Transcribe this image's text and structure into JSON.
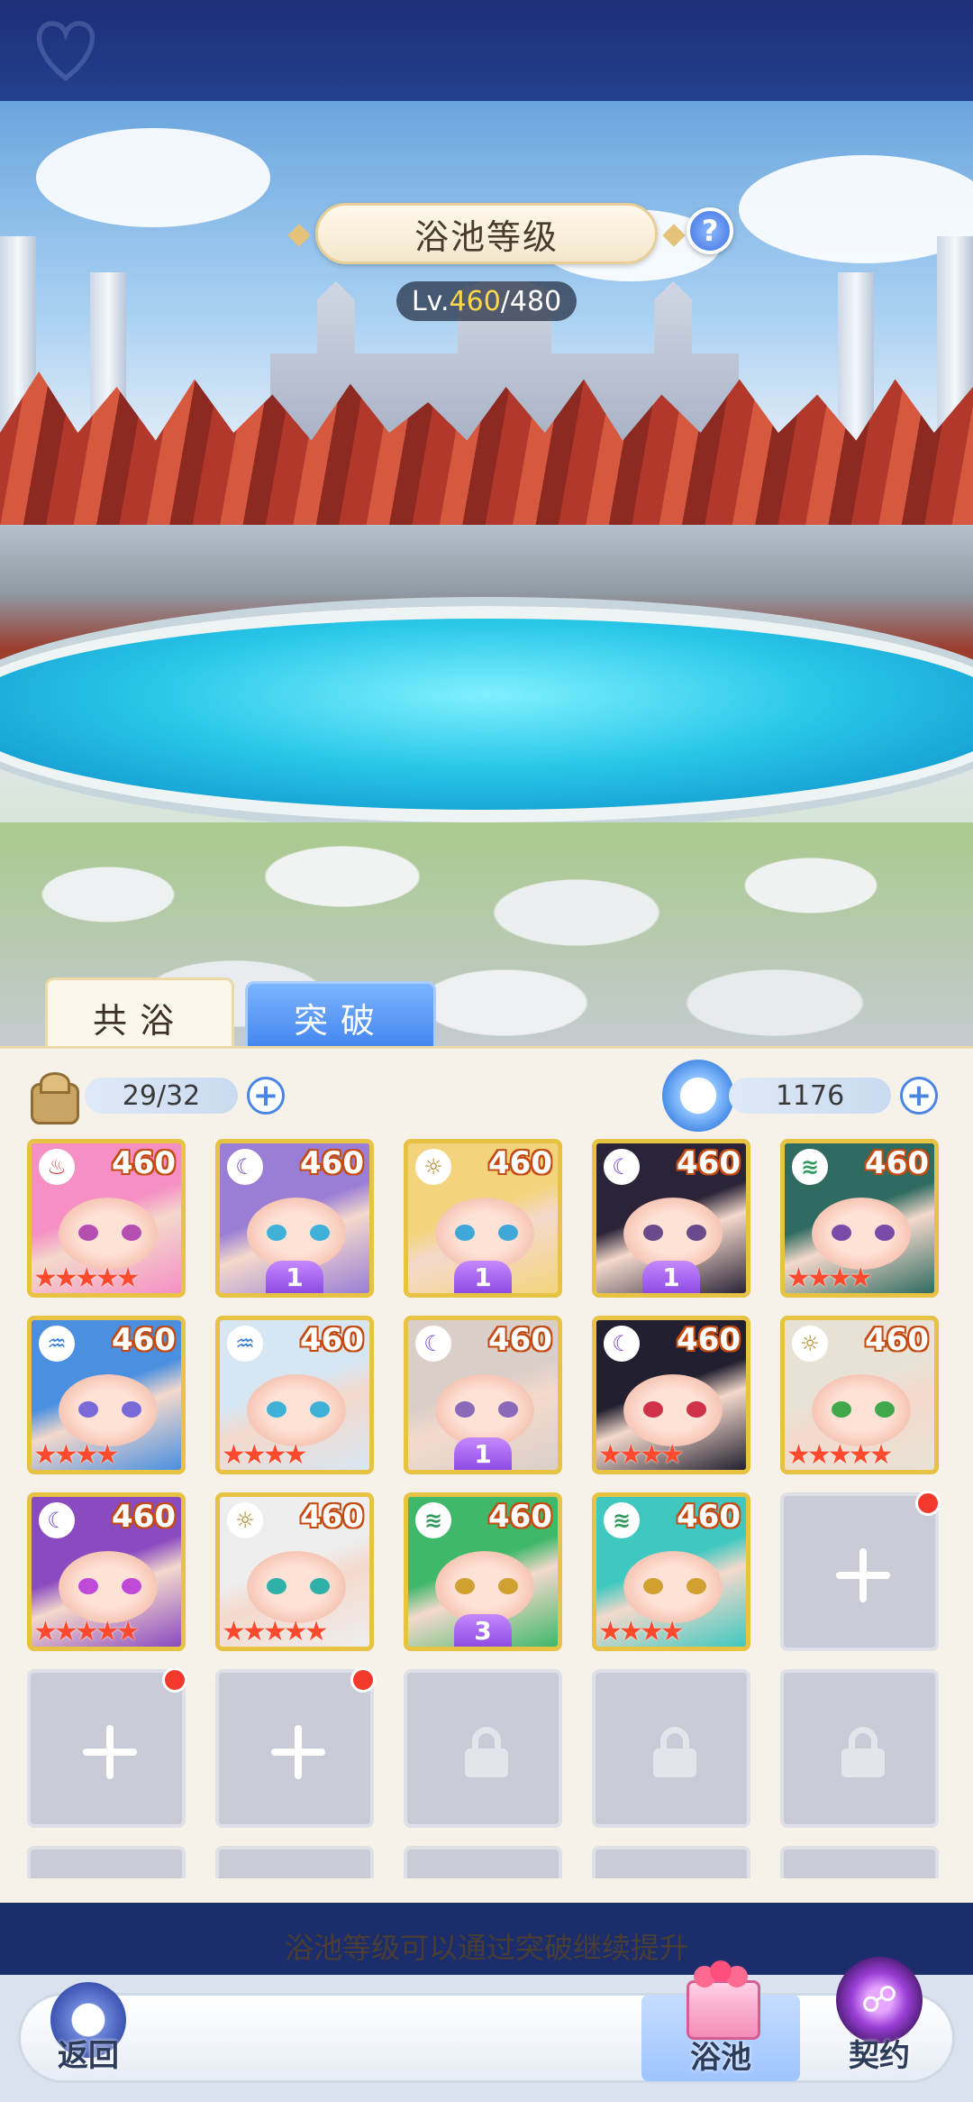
{
  "header": {
    "title": "浴池等级",
    "help_label": "?",
    "level_current": "460",
    "level_max": "/480",
    "level_prefix": "Lv."
  },
  "tabs": [
    {
      "label": "共浴",
      "active": true
    },
    {
      "label": "突破",
      "active": false
    }
  ],
  "resources": {
    "slots_value": "29/32",
    "slots_icon": "bag-icon",
    "currency_value": "1176",
    "currency_icon": "rabbit-water-icon"
  },
  "cards": [
    {
      "level": "460",
      "element": "fire",
      "stars": 5,
      "awaken": "",
      "hair": "#f58fc4",
      "eye": "#b44fb0"
    },
    {
      "level": "460",
      "element": "moon",
      "stars": 0,
      "awaken": "1",
      "hair": "#9a7ed6",
      "eye": "#3fb0d8"
    },
    {
      "level": "460",
      "element": "light",
      "stars": 0,
      "awaken": "1",
      "hair": "#f3d47c",
      "eye": "#3fa8d8"
    },
    {
      "level": "460",
      "element": "moon",
      "stars": 0,
      "awaken": "1",
      "hair": "#2b2438",
      "eye": "#6a4a8a"
    },
    {
      "level": "460",
      "element": "wind",
      "stars": 4,
      "awaken": "",
      "hair": "#2f6b60",
      "eye": "#7a4aa8"
    },
    {
      "level": "460",
      "element": "water",
      "stars": 4,
      "awaken": "",
      "hair": "#4a8fe0",
      "eye": "#7a6ad8"
    },
    {
      "level": "460",
      "element": "water",
      "stars": 4,
      "awaken": "",
      "hair": "#d7e6f3",
      "eye": "#3fb0d8"
    },
    {
      "level": "460",
      "element": "moon",
      "stars": 0,
      "awaken": "1",
      "hair": "#d9cfc8",
      "eye": "#8a6ab8"
    },
    {
      "level": "460",
      "element": "moon",
      "stars": 4,
      "awaken": "",
      "hair": "#222030",
      "eye": "#d0304a"
    },
    {
      "level": "460",
      "element": "light",
      "stars": 5,
      "awaken": "",
      "hair": "#e8e2d6",
      "eye": "#3fa84a"
    },
    {
      "level": "460",
      "element": "moon",
      "stars": 5,
      "awaken": "",
      "hair": "#8a4ac0",
      "eye": "#c04ad8"
    },
    {
      "level": "460",
      "element": "light",
      "stars": 5,
      "awaken": "",
      "hair": "#eeeeee",
      "eye": "#2fb0a8"
    },
    {
      "level": "460",
      "element": "wind",
      "stars": 0,
      "awaken": "3",
      "hair": "#3fb86a",
      "eye": "#d0a030"
    },
    {
      "level": "460",
      "element": "wind",
      "stars": 4,
      "awaken": "",
      "hair": "#3fc8c0",
      "eye": "#d0a030"
    }
  ],
  "element_glyphs": {
    "fire": "♨",
    "moon": "☾",
    "light": "☼",
    "wind": "≋",
    "water": "♒"
  },
  "element_colors": {
    "fire": "#d23a3a",
    "moon": "#7a4ad0",
    "light": "#b08a2a",
    "wind": "#2f9a5a",
    "water": "#2f7ad8"
  },
  "hint": "浴池等级可以通过突破继续提升",
  "nav": {
    "back_label": "返回",
    "pool_label": "浴池",
    "contract_label": "契约"
  }
}
